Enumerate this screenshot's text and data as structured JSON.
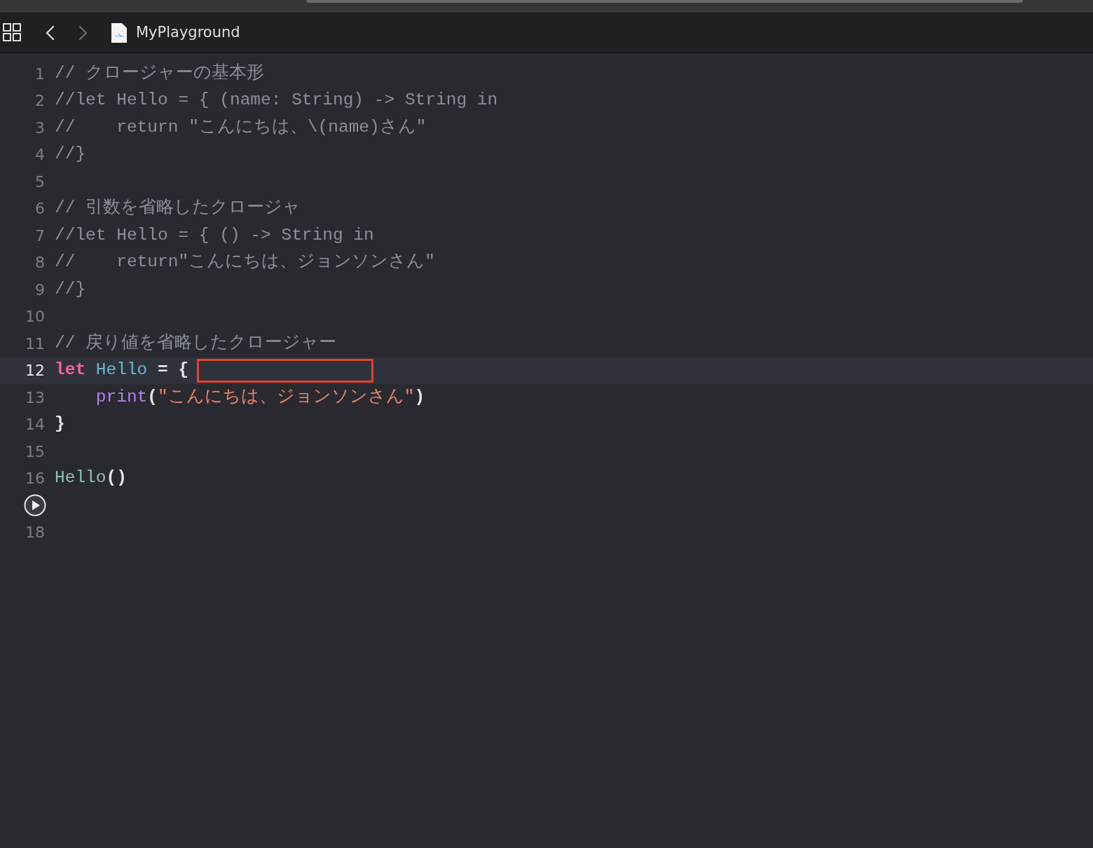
{
  "toolbar": {
    "nav_buttons": [
      {
        "kind": "back",
        "disabled": false
      },
      {
        "kind": "forward",
        "disabled": true
      }
    ],
    "file_name": "MyPlayground"
  },
  "editor": {
    "lines": [
      {
        "number": "1",
        "current": false,
        "tokens": [
          {
            "kind": "comment",
            "text": "// クロージャーの基本形"
          }
        ]
      },
      {
        "number": "2",
        "current": false,
        "tokens": [
          {
            "kind": "comment",
            "text": "//let Hello = { (name: String) -> String in"
          }
        ]
      },
      {
        "number": "3",
        "current": false,
        "tokens": [
          {
            "kind": "comment",
            "text": "//    return \"こんにちは、\\(name)さん\""
          }
        ]
      },
      {
        "number": "4",
        "current": false,
        "tokens": [
          {
            "kind": "comment",
            "text": "//}"
          }
        ]
      },
      {
        "number": "5",
        "current": false
      },
      {
        "number": "6",
        "current": false,
        "tokens": [
          {
            "kind": "comment",
            "text": "// 引数を省略したクロージャ"
          }
        ]
      },
      {
        "number": "7",
        "current": false,
        "tokens": [
          {
            "kind": "comment",
            "text": "//let Hello = { () -> String in"
          }
        ]
      },
      {
        "number": "8",
        "current": false,
        "tokens": [
          {
            "kind": "comment",
            "text": "//    return\"こんにちは、ジョンソンさん\""
          }
        ]
      },
      {
        "number": "9",
        "current": false,
        "tokens": [
          {
            "kind": "comment",
            "text": "//}"
          }
        ]
      },
      {
        "number": "10",
        "current": false
      },
      {
        "number": "11",
        "current": false,
        "tokens": [
          {
            "kind": "comment",
            "text": "// 戻り値を省略したクロージャー"
          }
        ]
      },
      {
        "number": "12",
        "current": true,
        "boxed": true,
        "tokens": [
          {
            "kind": "keyword",
            "text": "let"
          },
          {
            "kind": "declaration",
            "text": "Hello"
          },
          {
            "kind": "plain",
            "text": "= {"
          }
        ]
      },
      {
        "number": "13",
        "current": false,
        "indented": true,
        "tokens": [
          {
            "kind": "function",
            "text": "print"
          },
          {
            "kind": "plain",
            "text": "("
          },
          {
            "kind": "string",
            "text": "\"こんにちは、ジョンソンさん\""
          },
          {
            "kind": "plain",
            "text": ")"
          }
        ]
      },
      {
        "number": "14",
        "current": false,
        "tokens": [
          {
            "kind": "plain",
            "text": "}"
          }
        ]
      },
      {
        "number": "15",
        "current": false
      },
      {
        "number": "16",
        "current": false,
        "tokens": [
          {
            "kind": "call",
            "text": "Hello"
          },
          {
            "kind": "plain",
            "text": "()"
          }
        ]
      },
      {
        "run_button": true,
        "current": false
      },
      {
        "number": "18",
        "current": false
      }
    ]
  }
}
